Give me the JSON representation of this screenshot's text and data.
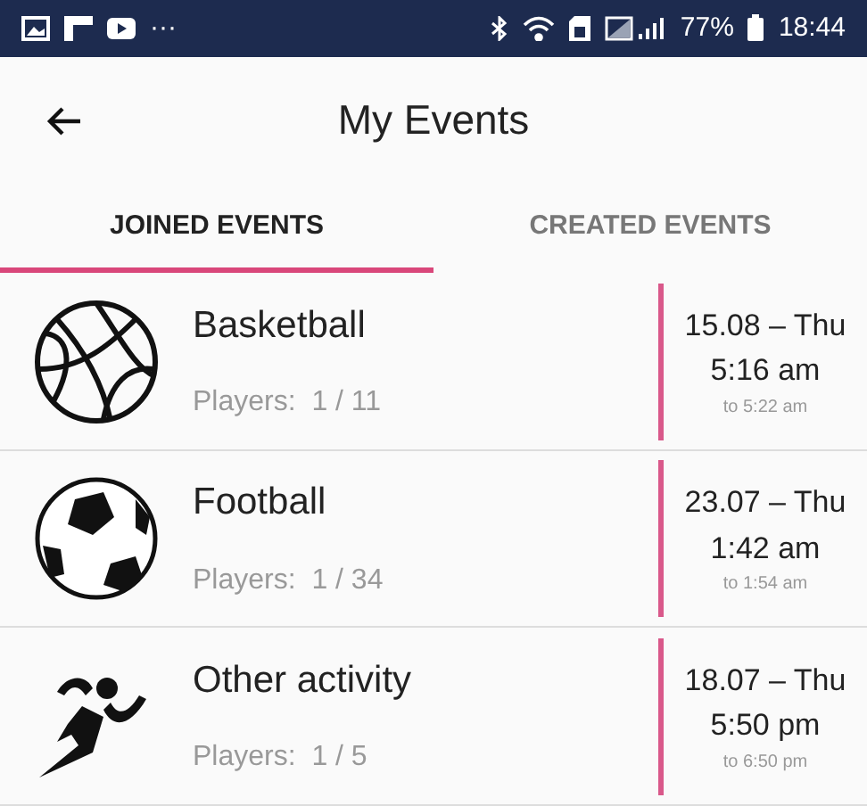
{
  "status_bar": {
    "overflow": "···",
    "battery": "77%",
    "time": "18:44"
  },
  "header": {
    "title": "My Events"
  },
  "tabs": [
    {
      "label": "JOINED EVENTS",
      "selected": true
    },
    {
      "label": "CREATED EVENTS",
      "selected": false
    }
  ],
  "events": [
    {
      "kind": "basketball",
      "name": "Basketball",
      "players": "Players:  1 / 11",
      "date": "15.08 – Thu",
      "time": "5:16 am",
      "end": "to 5:22 am"
    },
    {
      "kind": "football",
      "name": "Football",
      "players": "Players:  1 / 34",
      "date": "23.07 – Thu",
      "time": "1:42 am",
      "end": "to 1:54 am"
    },
    {
      "kind": "running",
      "name": "Other activity",
      "players": "Players:  1 / 5",
      "date": "18.07 – Thu",
      "time": "5:50 pm",
      "end": "to 6:50 pm"
    }
  ]
}
